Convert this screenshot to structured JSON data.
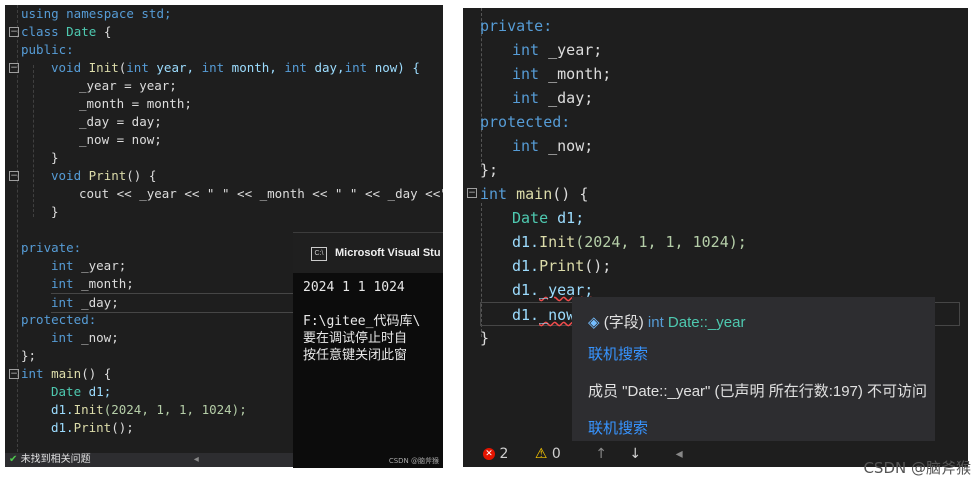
{
  "left": {
    "code": {
      "l1": "using namespace std;",
      "l2a": "class",
      "l2b": "Date",
      "l2c": "{",
      "l3": "public:",
      "l4a": "void",
      "l4b": "Init",
      "l4c": "(",
      "l4d": "int",
      "l4e": "year,",
      "l4f": "int",
      "l4g": "month,",
      "l4h": "int",
      "l4i": "day,",
      "l4j": "int",
      "l4k": "now) {",
      "l5": "_year = year;",
      "l6": "_month = month;",
      "l7": "_day = day;",
      "l8": "_now = now;",
      "l9": "}",
      "l10a": "void",
      "l10b": "Print",
      "l10c": "() {",
      "l11a": "cout << _year << \" \" << _month << \" \" << _day <<\" \"",
      "l12": "}",
      "l13": "private:",
      "l14a": "int",
      "l14b": "_year;",
      "l15a": "int",
      "l15b": "_month;",
      "l16a": "int",
      "l16b": "_day;",
      "l17": "protected:",
      "l18a": "int",
      "l18b": "_now;",
      "l19": "};",
      "l20a": "int",
      "l20b": "main",
      "l20c": "() {",
      "l21a": "Date",
      "l21b": "d1;",
      "l22a": "d1.",
      "l22b": "Init",
      "l22c": "(2024,",
      "l22d": "1,",
      "l22e": "1,",
      "l22f": "1024);",
      "l23a": "d1.",
      "l23b": "Print",
      "l23c": "();"
    },
    "status": "未找到相关问题",
    "console": {
      "title": "Microsoft Visual Stu",
      "icon": "C:\\",
      "out1": "2024 1 1 1024",
      "out2": "F:\\gitee_代码库\\",
      "out3": "要在调试停止时自",
      "out4": "按任意键关闭此窗",
      "watermark": "CSDN @脑斧猴"
    }
  },
  "right": {
    "code": {
      "r1": "private:",
      "r2a": "int",
      "r2b": "_year;",
      "r3a": "int",
      "r3b": "_month;",
      "r4a": "int",
      "r4b": "_day;",
      "r5": "protected:",
      "r6a": "int",
      "r6b": "_now;",
      "r7": "};",
      "r8a": "int",
      "r8b": "main",
      "r8c": "() {",
      "r9a": "Date",
      "r9b": "d1;",
      "r10a": "d1.",
      "r10b": "Init",
      "r10c": "(2024,",
      "r10d": "1,",
      "r10e": "1,",
      "r10f": "1024);",
      "r11a": "d1.",
      "r11b": "Print",
      "r11c": "();",
      "r12a": "d1.",
      "r12b": "_year;",
      "r13a": "d1.",
      "r13b": "_now;",
      "r14": "}"
    },
    "tooltip": {
      "kind": "(字段)",
      "sig_kw": "int",
      "sig_name": "Date::_year",
      "link1": "联机搜索",
      "message": "成员 \"Date::_year\" (已声明 所在行数:197) 不可访问",
      "link2": "联机搜索"
    },
    "status": {
      "errors": "2",
      "warnings": "0"
    }
  },
  "watermark": "CSDN @脑斧猴"
}
